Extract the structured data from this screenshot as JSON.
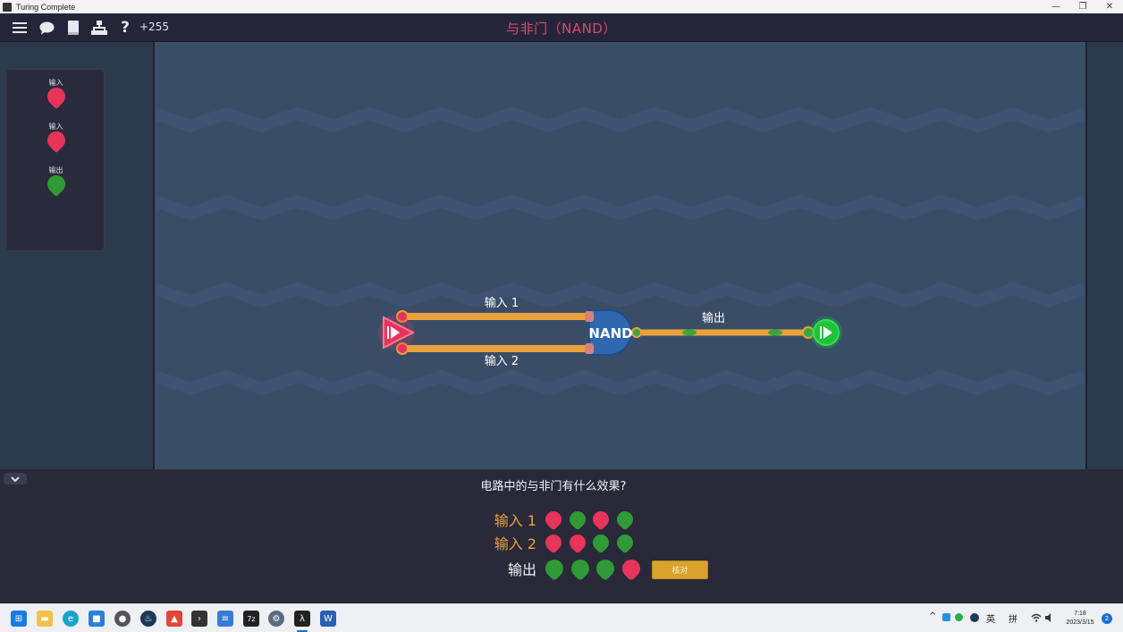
{
  "window": {
    "title": "Turing Complete",
    "minimize": "—",
    "maximize": "❐",
    "close": "✕"
  },
  "topbar": {
    "menu_icon": "menu-icon",
    "chat_icon": "chat-icon",
    "book_icon": "book-icon",
    "hierarchy_icon": "hierarchy-icon",
    "help_label": "?",
    "counter": "+255",
    "level_title": "与非门（NAND）"
  },
  "left_panel": {
    "pins": [
      {
        "label": "输入",
        "color": "#e8345a"
      },
      {
        "label": "输入",
        "color": "#e8345a"
      },
      {
        "label": "输出",
        "color": "#2f9a36"
      }
    ]
  },
  "circuit": {
    "gate_label": "NAND",
    "wire_input1_label": "输入 1",
    "wire_input2_label": "输入 2",
    "wire_output_label": "输出",
    "wire_color": "#e9a23b",
    "input_color": "#e8345a",
    "output_color": "#1fc23a",
    "gate_color": "#2f68b0"
  },
  "bottom": {
    "collapse_icon": "chevron-down-icon",
    "question": "电路中的与非门有什么效果?",
    "rows": [
      {
        "label": "输入 1",
        "label_color": "#e7a23a",
        "cells": [
          "red",
          "green",
          "red",
          "green"
        ]
      },
      {
        "label": "输入 2",
        "label_color": "#e7a23a",
        "cells": [
          "red",
          "red",
          "green",
          "green"
        ]
      },
      {
        "label": "输出",
        "label_color": "#f2f2f6",
        "cells": [
          "green",
          "green",
          "green",
          "red"
        ]
      }
    ],
    "check_label": "核对",
    "red_color": "#e8345a",
    "green_color": "#2f9a36"
  },
  "taskbar": {
    "apps": [
      {
        "name": "windows-start-icon",
        "color": "#1a7be0",
        "glyph": "⊞"
      },
      {
        "name": "file-explorer-icon",
        "color": "#f2c14a",
        "glyph": "▬"
      },
      {
        "name": "edge-browser-icon",
        "color": "#1da2c8",
        "glyph": "e"
      },
      {
        "name": "store-icon",
        "color": "#2a7fd6",
        "glyph": "■"
      },
      {
        "name": "game-app-icon",
        "color": "#555",
        "glyph": "●"
      },
      {
        "name": "steam-icon",
        "color": "#1b3a5a",
        "glyph": "♨"
      },
      {
        "name": "drive-app-icon",
        "color": "#e0463a",
        "glyph": "▲"
      },
      {
        "name": "terminal-icon",
        "color": "#333",
        "glyph": "›"
      },
      {
        "name": "notepad-icon",
        "color": "#3a7bd5",
        "glyph": "≡"
      },
      {
        "name": "7zip-icon",
        "color": "#222",
        "glyph": "7z"
      },
      {
        "name": "settings-icon",
        "color": "#5a6a80",
        "glyph": "⚙"
      },
      {
        "name": "turing-complete-icon",
        "color": "#222",
        "glyph": "λ"
      },
      {
        "name": "word-icon",
        "color": "#2a5fb3",
        "glyph": "W"
      }
    ],
    "tray_chevron": "^",
    "ime_lang": "英",
    "ime_mode": "拼",
    "time": "7:18",
    "date": "2023/3/15",
    "notification_count": "2"
  }
}
